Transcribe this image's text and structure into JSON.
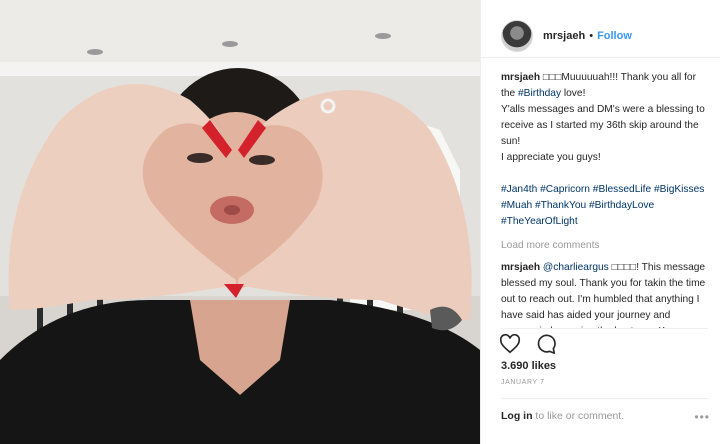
{
  "post": {
    "username": "mrsjaeh",
    "separator": "•",
    "follow_label": "Follow"
  },
  "caption": {
    "username": "mrsjaeh",
    "text_before_tag": "□□□Muuuuuah!!! Thank you all for the ",
    "tag": "#Birthday",
    "text_after_tag": " love!",
    "line2": "Y'alls messages and DM's were a blessing to receive as I started my 36th skip around the sun!",
    "line3": "I appreciate you guys!",
    "hashtags": [
      "#Jan4th",
      "#Capricorn",
      "#BlessedLife",
      "#BigKisses",
      "#Muah",
      "#ThankYou",
      "#BirthdayLove",
      "#TheYearOfLight"
    ]
  },
  "load_more_label": "Load more comments",
  "comment": {
    "username": "mrsjaeh",
    "mention": "@charlieargus",
    "text_before_mention": " ",
    "text": " □□□□! This message blessed my soul. Thank you for takin the time out to reach out. I'm humbled that anything I have said has aided your journey and process in becoming the best you. Keep striving for"
  },
  "actions": {
    "like_icon": "heart-icon",
    "comment_icon": "comment-bubble-icon"
  },
  "likes_text": "3.690 likes",
  "date_text": "JANUARY 7",
  "login": {
    "link": "Log in",
    "rest": " to like or comment."
  },
  "more_icon": "more-options-icon",
  "colors": {
    "link": "#3897f0",
    "hashtag": "#003569",
    "muted": "#999999",
    "text": "#262626"
  },
  "photo": {
    "description_icon": "photo-image"
  }
}
